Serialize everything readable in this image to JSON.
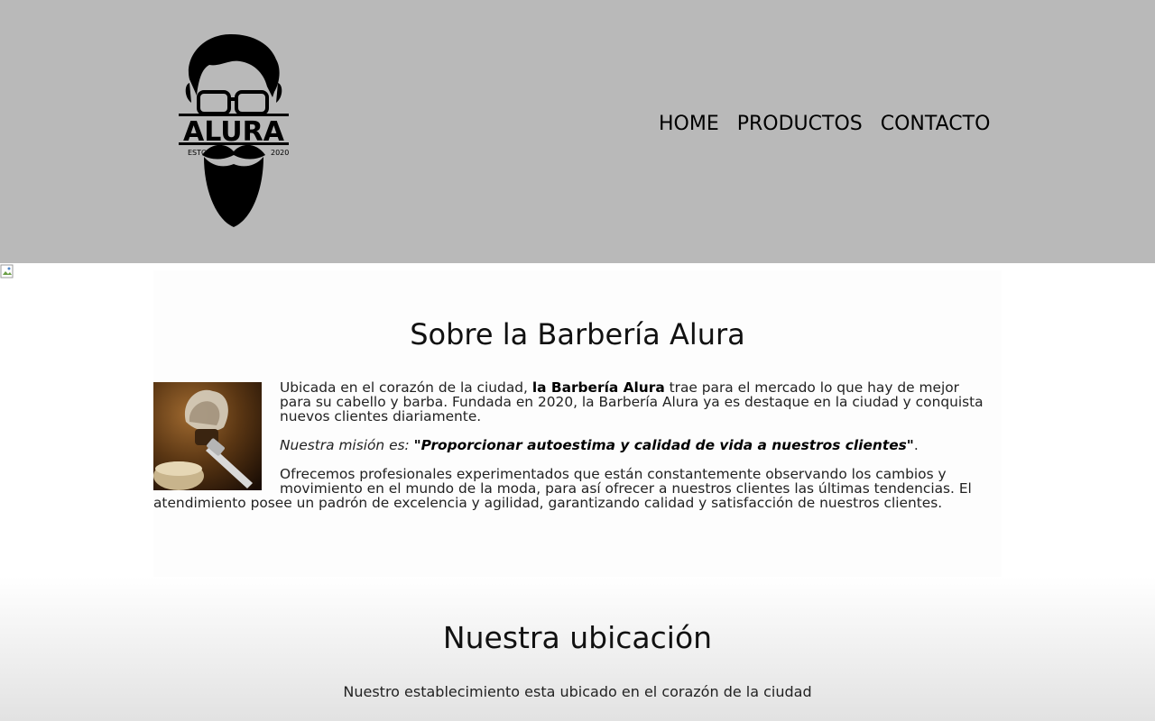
{
  "header": {
    "logo": {
      "brand": "ALURA",
      "left_tag": "ESTO",
      "right_tag": "2020"
    },
    "nav": [
      {
        "label": "HOME"
      },
      {
        "label": "PRODUCTOS"
      },
      {
        "label": "CONTACTO"
      }
    ],
    "background": "#b9b9b9"
  },
  "about": {
    "title": "Sobre la Barbería Alura",
    "p1_before": "Ubicada en el corazón de la ciudad, ",
    "p1_strong": "la Barbería Alura",
    "p1_after": " trae para el mercado lo que hay de mejor para su cabello y barba. Fundada en 2020, la Barbería Alura ya es destaque en la ciudad y conquista nuevos clientes diariamente.",
    "mission_label": "Nuestra misión es: ",
    "mission_quote": "\"Proporcionar autoestima y calidad de vida a nuestros clientes\"",
    "mission_end": ".",
    "p3": "Ofrecemos profesionales experimentados que están constantemente observando los cambios y movimiento en el mundo de la moda, para así ofrecer a nuestros clientes las últimas tendencias. El atendimiento posee un padrón de excelencia y agilidad, garantizando calidad y satisfacción de nuestros clientes."
  },
  "location": {
    "title": "Nuestra ubicación",
    "text": "Nuestro establecimiento esta ubicado en el corazón de la ciudad"
  }
}
